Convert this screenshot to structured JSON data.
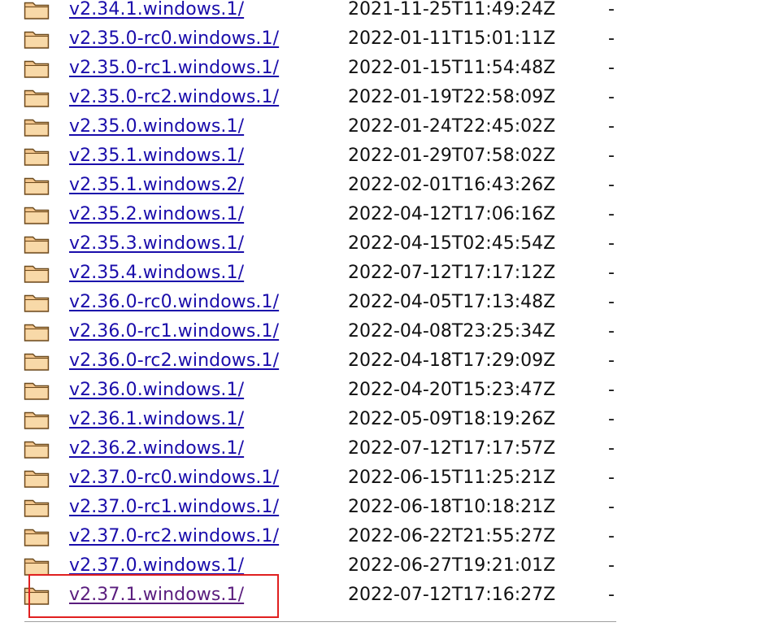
{
  "accent_colors": {
    "link": "#1a0dab",
    "visited_link": "#5a1d7e",
    "highlight": "#e02020",
    "folder_fill": "#f3c58c",
    "folder_stroke": "#6b4a1e"
  },
  "rows": [
    {
      "name": "v2.34.1.windows.1/",
      "modified": "2021-11-25T11:49:24Z",
      "size": "-",
      "icon": "folder-icon"
    },
    {
      "name": "v2.35.0-rc0.windows.1/",
      "modified": "2022-01-11T15:01:11Z",
      "size": "-",
      "icon": "folder-icon"
    },
    {
      "name": "v2.35.0-rc1.windows.1/",
      "modified": "2022-01-15T11:54:48Z",
      "size": "-",
      "icon": "folder-icon"
    },
    {
      "name": "v2.35.0-rc2.windows.1/",
      "modified": "2022-01-19T22:58:09Z",
      "size": "-",
      "icon": "folder-icon"
    },
    {
      "name": "v2.35.0.windows.1/",
      "modified": "2022-01-24T22:45:02Z",
      "size": "-",
      "icon": "folder-icon"
    },
    {
      "name": "v2.35.1.windows.1/",
      "modified": "2022-01-29T07:58:02Z",
      "size": "-",
      "icon": "folder-icon"
    },
    {
      "name": "v2.35.1.windows.2/",
      "modified": "2022-02-01T16:43:26Z",
      "size": "-",
      "icon": "folder-icon"
    },
    {
      "name": "v2.35.2.windows.1/",
      "modified": "2022-04-12T17:06:16Z",
      "size": "-",
      "icon": "folder-icon"
    },
    {
      "name": "v2.35.3.windows.1/",
      "modified": "2022-04-15T02:45:54Z",
      "size": "-",
      "icon": "folder-icon"
    },
    {
      "name": "v2.35.4.windows.1/",
      "modified": "2022-07-12T17:17:12Z",
      "size": "-",
      "icon": "folder-icon"
    },
    {
      "name": "v2.36.0-rc0.windows.1/",
      "modified": "2022-04-05T17:13:48Z",
      "size": "-",
      "icon": "folder-icon"
    },
    {
      "name": "v2.36.0-rc1.windows.1/",
      "modified": "2022-04-08T23:25:34Z",
      "size": "-",
      "icon": "folder-icon"
    },
    {
      "name": "v2.36.0-rc2.windows.1/",
      "modified": "2022-04-18T17:29:09Z",
      "size": "-",
      "icon": "folder-icon"
    },
    {
      "name": "v2.36.0.windows.1/",
      "modified": "2022-04-20T15:23:47Z",
      "size": "-",
      "icon": "folder-icon"
    },
    {
      "name": "v2.36.1.windows.1/",
      "modified": "2022-05-09T18:19:26Z",
      "size": "-",
      "icon": "folder-icon"
    },
    {
      "name": "v2.36.2.windows.1/",
      "modified": "2022-07-12T17:17:57Z",
      "size": "-",
      "icon": "folder-icon"
    },
    {
      "name": "v2.37.0-rc0.windows.1/",
      "modified": "2022-06-15T11:25:21Z",
      "size": "-",
      "icon": "folder-icon"
    },
    {
      "name": "v2.37.0-rc1.windows.1/",
      "modified": "2022-06-18T10:18:21Z",
      "size": "-",
      "icon": "folder-icon"
    },
    {
      "name": "v2.37.0-rc2.windows.1/",
      "modified": "2022-06-22T21:55:27Z",
      "size": "-",
      "icon": "folder-icon"
    },
    {
      "name": "v2.37.0.windows.1/",
      "modified": "2022-06-27T19:21:01Z",
      "size": "-",
      "icon": "folder-icon"
    },
    {
      "name": "v2.37.1.windows.1/",
      "modified": "2022-07-12T17:16:27Z",
      "size": "-",
      "icon": "folder-icon",
      "visited": true,
      "highlighted": true
    }
  ]
}
